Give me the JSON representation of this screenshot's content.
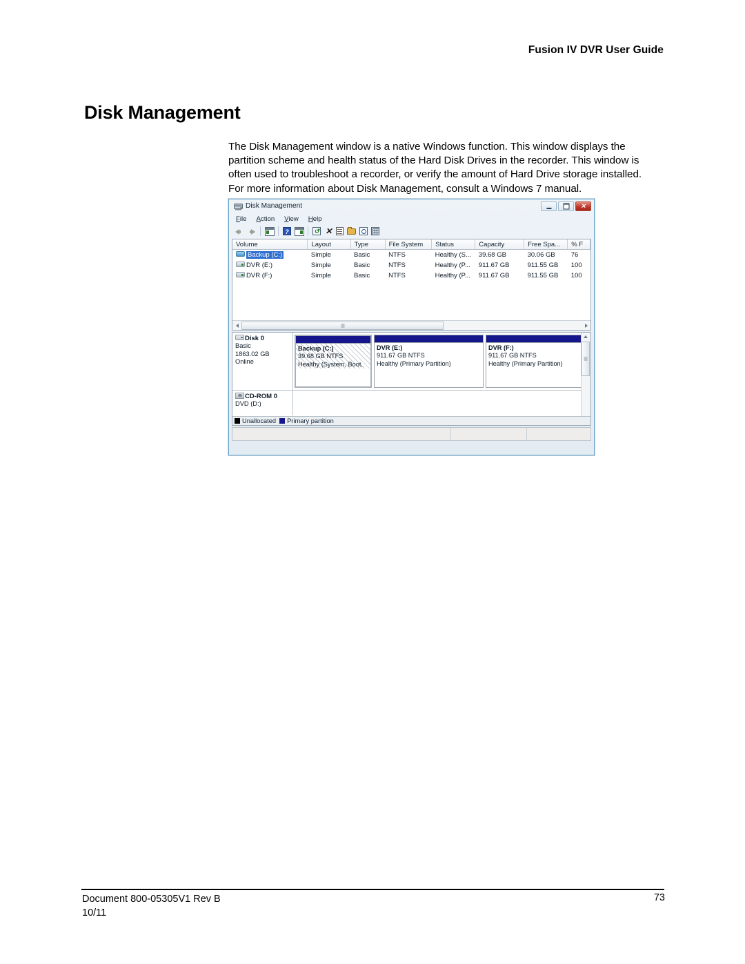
{
  "document": {
    "header_right": "Fusion IV DVR User Guide",
    "title": "Disk Management",
    "paragraph": "The Disk Management window is a native Windows function. This window displays the partition scheme and health status of the Hard Disk Drives in the recorder. This window is often used to troubleshoot a recorder, or verify the amount of Hard Drive storage installed. For more information about Disk Management, consult a Windows 7 manual.",
    "footer_left_line1": "Document 800-05305V1 Rev B",
    "footer_left_line2": "10/11",
    "footer_page_number": "73"
  },
  "window": {
    "title": "Disk Management",
    "icon": "disk-management-icon",
    "buttons": {
      "minimize": "minimize-button",
      "maximize": "maximize-button",
      "close": "close-button",
      "close_glyph": "✕"
    },
    "menu": [
      {
        "label": "File",
        "accel": "F"
      },
      {
        "label": "Action",
        "accel": "A"
      },
      {
        "label": "View",
        "accel": "V"
      },
      {
        "label": "Help",
        "accel": "H"
      }
    ],
    "toolbar": [
      {
        "name": "back-icon"
      },
      {
        "name": "forward-icon"
      },
      {
        "name": "show-hide-console-tree-icon"
      },
      {
        "name": "help-icon",
        "glyph": "?"
      },
      {
        "name": "show-hide-action-pane-icon"
      },
      {
        "name": "rescan-disks-icon",
        "glyph": "↻"
      },
      {
        "name": "delete-icon",
        "glyph": "✕"
      },
      {
        "name": "properties-icon"
      },
      {
        "name": "open-icon"
      },
      {
        "name": "search-icon"
      },
      {
        "name": "export-list-icon"
      }
    ]
  },
  "volume_list": {
    "columns": [
      "Volume",
      "Layout",
      "Type",
      "File System",
      "Status",
      "Capacity",
      "Free Spa...",
      "% F"
    ],
    "rows": [
      {
        "volume": "Backup (C:)",
        "layout": "Simple",
        "type": "Basic",
        "file_system": "NTFS",
        "status": "Healthy (S...",
        "capacity": "39.68 GB",
        "free_space": "30.06 GB",
        "percent_free": "76",
        "selected": true,
        "icon": "drive-icon-selected"
      },
      {
        "volume": "DVR (E:)",
        "layout": "Simple",
        "type": "Basic",
        "file_system": "NTFS",
        "status": "Healthy (P...",
        "capacity": "911.67 GB",
        "free_space": "911.55 GB",
        "percent_free": "100",
        "selected": false,
        "icon": "drive-icon"
      },
      {
        "volume": "DVR (F:)",
        "layout": "Simple",
        "type": "Basic",
        "file_system": "NTFS",
        "status": "Healthy (P...",
        "capacity": "911.67 GB",
        "free_space": "911.55 GB",
        "percent_free": "100",
        "selected": false,
        "icon": "drive-icon"
      }
    ]
  },
  "graphical_view": {
    "disks": [
      {
        "name": "Disk 0",
        "type": "Basic",
        "size": "1863.02 GB",
        "state": "Online",
        "icon": "hard-disk-icon",
        "partitions": [
          {
            "label": "Backup  (C:)",
            "size": "39.68 GB NTFS",
            "status": "Healthy (System, Boot,",
            "hatched": true
          },
          {
            "label": "DVR  (E:)",
            "size": "911.67 GB NTFS",
            "status": "Healthy (Primary Partition)",
            "hatched": false
          },
          {
            "label": "DVR  (F:)",
            "size": "911.67 GB NTFS",
            "status": "Healthy (Primary Partition)",
            "hatched": false
          }
        ]
      },
      {
        "name": "CD-ROM 0",
        "type": "DVD (D:)",
        "size": "",
        "state": "",
        "icon": "cd-rom-icon",
        "partitions": []
      }
    ],
    "legend": [
      {
        "label": "Unallocated",
        "color": "#000000"
      },
      {
        "label": "Primary partition",
        "color": "#16168c"
      }
    ]
  },
  "colors": {
    "primary_partition": "#16168c",
    "unallocated": "#000000",
    "selection": "#2f6fd0",
    "window_border": "#6aa5c9"
  }
}
